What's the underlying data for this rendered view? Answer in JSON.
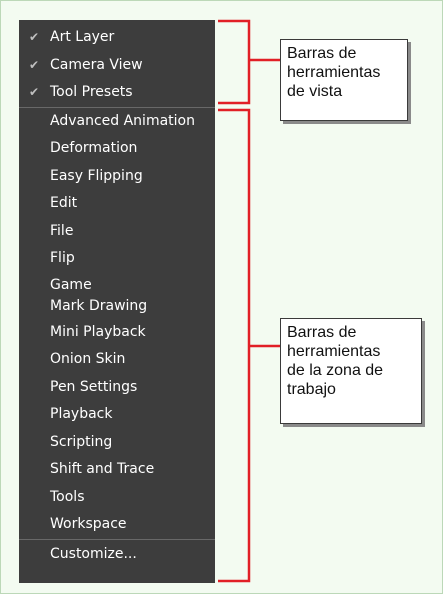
{
  "menu": {
    "checked_items": [
      {
        "label": "Art Layer",
        "checked": true
      },
      {
        "label": "Camera View",
        "checked": true
      },
      {
        "label": "Tool Presets",
        "checked": true
      }
    ],
    "workspace_items": [
      "Advanced Animation",
      "Deformation",
      "Easy Flipping",
      "Edit",
      "File",
      "Flip",
      "Game",
      "Mark Drawing",
      "Mini Playback",
      "Onion Skin",
      "Pen Settings",
      "Playback",
      "Scripting",
      "Shift and Trace",
      "Tools",
      "Workspace"
    ],
    "customize_label": "Customize...",
    "check_glyph": "✔",
    "background_color": "#3d3d3d"
  },
  "callouts": {
    "view_toolbars": [
      "Barras de",
      "herramientas",
      "de vista"
    ],
    "workspace_toolbars": [
      "Barras de",
      "herramientas",
      "de la zona de",
      "trabajo"
    ]
  },
  "colors": {
    "accent_red": "#e11f26",
    "page_background": "#f3fbf1"
  }
}
